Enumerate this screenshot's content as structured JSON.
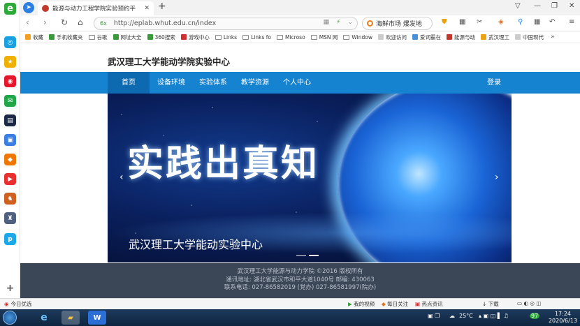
{
  "browser": {
    "tab_title": "能源与动力工程学院实验预约平",
    "url": "http://eplab.whut.edu.cn/index",
    "secure_label": "6x",
    "search_text": "海鲜市场 爆发地",
    "new_tab": "+",
    "window_controls": [
      "最小化",
      "最大化",
      "关闭"
    ]
  },
  "bookmarks": {
    "items": [
      {
        "label": "收藏",
        "icon": "star-icon",
        "color": "#f0a020"
      },
      {
        "label": "手机收藏夹",
        "icon": "phone-icon",
        "color": "#3a9a3a"
      },
      {
        "label": "谷歌",
        "icon": "folder-icon",
        "color": ""
      },
      {
        "label": "网址大全",
        "icon": "globe-icon",
        "color": "#3a9a3a"
      },
      {
        "label": "360搜索",
        "icon": "search-icon",
        "color": "#3a9a3a"
      },
      {
        "label": "游戏中心",
        "icon": "game-icon",
        "color": "#d03030"
      },
      {
        "label": "Links",
        "icon": "folder-icon",
        "color": ""
      },
      {
        "label": "Links fo",
        "icon": "folder-icon",
        "color": ""
      },
      {
        "label": "Microso",
        "icon": "folder-icon",
        "color": ""
      },
      {
        "label": "MSN 网",
        "icon": "folder-icon",
        "color": ""
      },
      {
        "label": "Window",
        "icon": "folder-icon",
        "color": ""
      },
      {
        "label": "欢迎访问",
        "icon": "doc-icon",
        "color": "#ccc"
      },
      {
        "label": "爱词霸在",
        "icon": "dict-icon",
        "color": "#4a90d9"
      },
      {
        "label": "能源与动",
        "icon": "site-icon",
        "color": "#c0392b"
      },
      {
        "label": "武汉理工",
        "icon": "site-icon",
        "color": "#e8a317"
      },
      {
        "label": "中国现代",
        "icon": "doc-icon",
        "color": "#ccc"
      }
    ],
    "more": "»"
  },
  "site": {
    "title": "武汉理工大学能动学院实验中心",
    "nav": [
      "首页",
      "设备环境",
      "实验体系",
      "教学资源",
      "个人中心"
    ],
    "login": "登录",
    "banner_slogan": "实践出真知",
    "banner_caption": "武汉理工大学能动实验中心",
    "prev_arrow": "‹",
    "next_arrow": "›",
    "footer_lines": [
      "武汉理工大学能源与动力学院 ©2016 版权所有",
      "通讯地址: 湖北省武汉市和平大道1040号 邮编: 430063",
      "联系电话: 027-86582019 (党办) 027-86581997(院办)"
    ]
  },
  "statusbar": {
    "left": "今日优选",
    "items": [
      "我的视频",
      "每日关注",
      "热点资讯",
      "下载"
    ]
  },
  "taskbar": {
    "weather": "25°C",
    "time": "17:24",
    "date": "2020/6/13",
    "wps_label": "W"
  },
  "colors": {
    "nav_blue": "#1683d1",
    "nav_active": "#0d6ab0",
    "footer_bg": "#3b4656"
  }
}
